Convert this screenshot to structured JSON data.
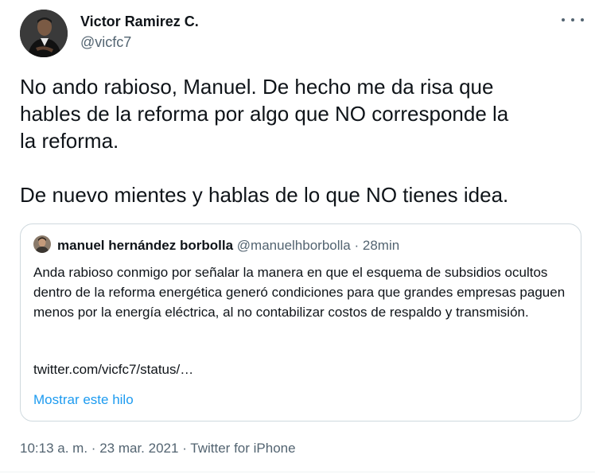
{
  "author": {
    "display_name": "Victor Ramirez C.",
    "handle": "@vicfc7"
  },
  "tweet": {
    "text": "No ando rabioso, Manuel. De hecho me da risa que\nhables de la reforma por algo que NO corresponde la\nla reforma.\n\nDe nuevo mientes y hablas de lo que NO tienes idea."
  },
  "quoted_tweet": {
    "display_name": "manuel hernández borbolla",
    "handle": "@manuelhborbolla",
    "separator": "·",
    "time_ago": "28min",
    "text": "Anda rabioso conmigo por señalar la manera en que el esquema de subsidios ocultos dentro de la reforma energética generó condiciones para que grandes empresas paguen menos por la energía eléctrica, al no contabilizar costos de respaldo y transmisión.",
    "link": "twitter.com/vicfc7/status/…",
    "show_thread": "Mostrar este hilo"
  },
  "footer": {
    "time": "10:13 a. m.",
    "date": "23 mar. 2021",
    "source": "Twitter for iPhone",
    "separator": "·"
  },
  "colors": {
    "text": "#0f1419",
    "secondary": "#536471",
    "link": "#1d9bf0",
    "border": "#cfd9de"
  }
}
